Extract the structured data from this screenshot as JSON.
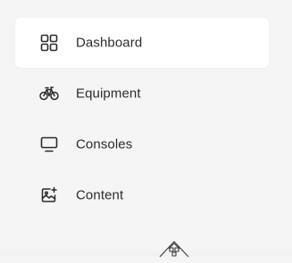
{
  "nav": {
    "items": [
      {
        "label": "Dashboard",
        "icon": "grid-icon",
        "active": true
      },
      {
        "label": "Equipment",
        "icon": "bicycle-icon",
        "active": false
      },
      {
        "label": "Consoles",
        "icon": "monitor-icon",
        "active": false
      },
      {
        "label": "Content",
        "icon": "image-sparkle-icon",
        "active": false
      }
    ]
  },
  "colors": {
    "background": "#f5f5f5",
    "active_background": "#ffffff",
    "text": "#2b2b2b",
    "icon": "#2b2b2b"
  },
  "footer": {
    "logo_icon": "logo-icon"
  }
}
